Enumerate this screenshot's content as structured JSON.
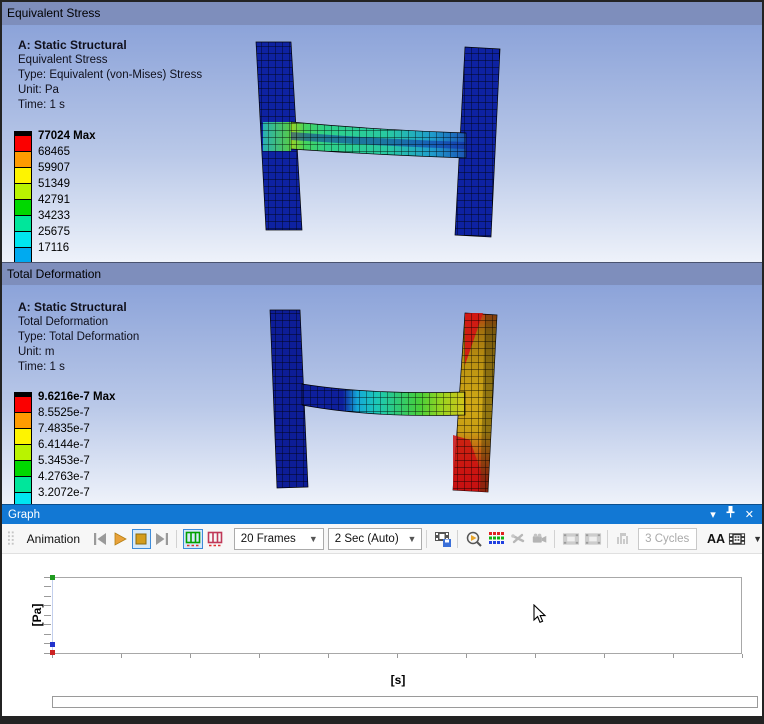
{
  "panels": {
    "stress": {
      "title": "Equivalent Stress",
      "info": {
        "heading": "A: Static Structural",
        "line1": "Equivalent Stress",
        "line2": "Type: Equivalent (von-Mises) Stress",
        "line3": "Unit: Pa",
        "line4": "Time: 1 s"
      },
      "legend": {
        "values": [
          "77024 Max",
          "68465",
          "59907",
          "51349",
          "42791",
          "34233",
          "25675",
          "17116"
        ],
        "colors": [
          "#fb0000",
          "#ff9b00",
          "#fef400",
          "#b9f300",
          "#00d800",
          "#00e69b",
          "#00e6f0",
          "#00aaf0"
        ]
      }
    },
    "deformation": {
      "title": "Total Deformation",
      "info": {
        "heading": "A: Static Structural",
        "line1": "Total Deformation",
        "line2": "Type: Total Deformation",
        "line3": "Unit: m",
        "line4": "Time: 1 s"
      },
      "legend": {
        "values": [
          "9.6216e-7 Max",
          "8.5525e-7",
          "7.4835e-7",
          "6.4144e-7",
          "5.3453e-7",
          "4.2763e-7",
          "3.2072e-7"
        ],
        "colors": [
          "#fb0000",
          "#ff9b00",
          "#fef400",
          "#b9f300",
          "#00d800",
          "#00e69b",
          "#00e6f0"
        ]
      }
    },
    "graph": {
      "title": "Graph",
      "toolbar": {
        "animation_label": "Animation",
        "frames_value": "20 Frames",
        "duration_value": "2 Sec (Auto)",
        "cycles_value": "3 Cycles",
        "aa_label": "AA"
      },
      "chart": {
        "ylabel": "[Pa]",
        "xlabel": "[s]"
      }
    }
  },
  "icons": {
    "collapse_glyph": "▾",
    "close_glyph": "✕",
    "dropdown_glyph": "▼",
    "overflow_glyph": "▼"
  },
  "chart_data": {
    "type": "scatter",
    "title": "",
    "xlabel": "[s]",
    "ylabel": "[Pa]",
    "x_ticks_count": 11,
    "y_ticks_count": 9,
    "grid": false,
    "legend_position": "none",
    "points": [
      {
        "x": 0,
        "y_rel": 1.0,
        "color": "#1f9a1f",
        "name": "max-value-marker"
      },
      {
        "x": 0,
        "y_rel": 0.09,
        "color": "#2233cc",
        "name": "low-value-marker"
      },
      {
        "x": 0,
        "y_rel": 0.0,
        "color": "#cc2222",
        "name": "min-value-marker"
      }
    ]
  }
}
